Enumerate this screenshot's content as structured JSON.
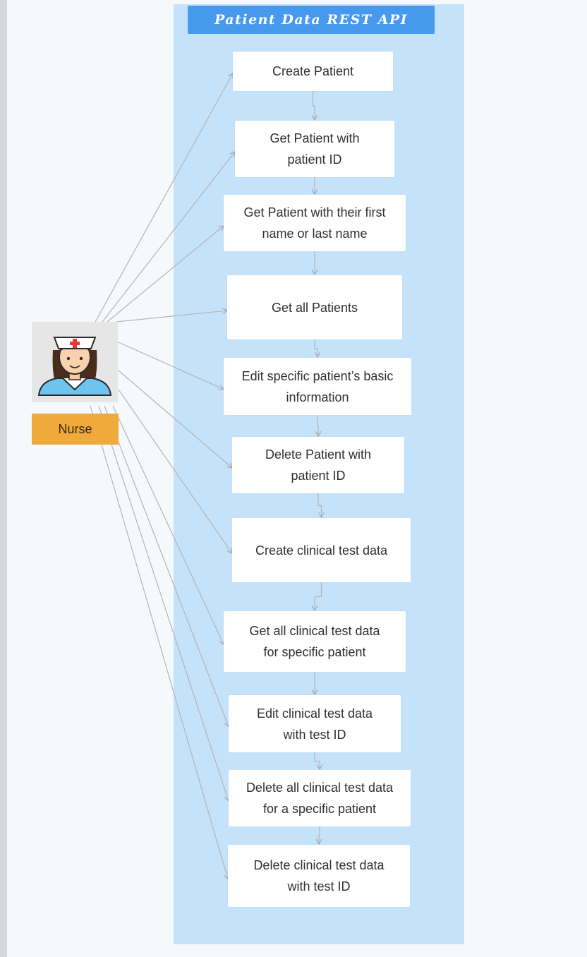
{
  "diagram": {
    "title": "Patient Data REST API",
    "actor": {
      "label": "Nurse",
      "icon": "nurse-icon"
    },
    "steps": [
      {
        "lines": [
          "Create Patient"
        ]
      },
      {
        "lines": [
          "Get Patient with",
          "patient ID"
        ]
      },
      {
        "lines": [
          "Get Patient with their first",
          "name or last name"
        ]
      },
      {
        "lines": [
          "Get all Patients"
        ]
      },
      {
        "lines": [
          "Edit specific patient’s basic",
          "information"
        ]
      },
      {
        "lines": [
          "Delete Patient with",
          "patient ID"
        ]
      },
      {
        "lines": [
          "Create clinical test data"
        ]
      },
      {
        "lines": [
          "Get all clinical test data",
          "for specific patient"
        ]
      },
      {
        "lines": [
          "Edit clinical test data",
          "with test ID"
        ]
      },
      {
        "lines": [
          "Delete all clinical test data",
          "for a specific patient"
        ]
      },
      {
        "lines": [
          "Delete clinical test data",
          "with test ID"
        ]
      }
    ],
    "colors": {
      "container": "#c5e2fb",
      "title_bar": "#4799ee",
      "actor_label": "#f0aa3c",
      "connector": "#b4b4b4"
    }
  }
}
